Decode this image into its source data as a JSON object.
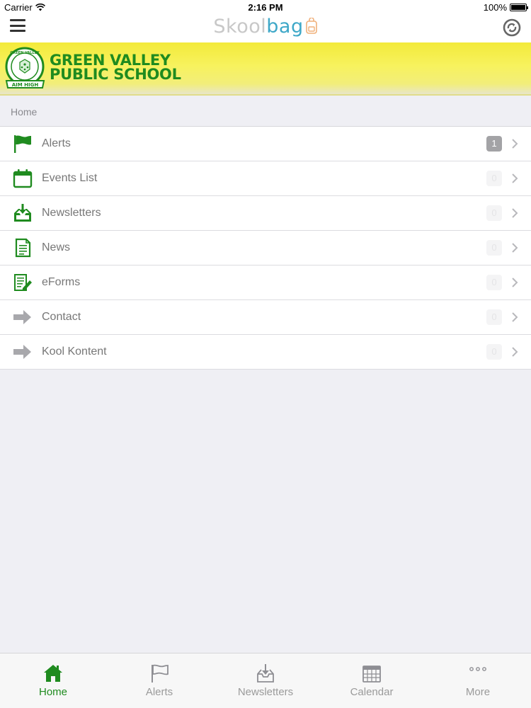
{
  "status_bar": {
    "carrier": "Carrier",
    "time": "2:16 PM",
    "battery": "100%"
  },
  "nav_bar": {
    "logo_part1": "Skool",
    "logo_part2": "bag"
  },
  "banner": {
    "school_line1": "GREEN VALLEY",
    "school_line2": "PUBLIC SCHOOL",
    "crest_motto": "AIM HIGH",
    "crest_top": "GREEN VALLEY"
  },
  "breadcrumb": "Home",
  "menu": [
    {
      "label": "Alerts",
      "badge": "1",
      "icon": "flag-icon"
    },
    {
      "label": "Events List",
      "badge": "0",
      "icon": "calendar-icon"
    },
    {
      "label": "Newsletters",
      "badge": "0",
      "icon": "inbox-download-icon"
    },
    {
      "label": "News",
      "badge": "0",
      "icon": "document-icon"
    },
    {
      "label": "eForms",
      "badge": "0",
      "icon": "form-edit-icon"
    },
    {
      "label": "Contact",
      "badge": "0",
      "icon": "arrow-right-icon"
    },
    {
      "label": "Kool Kontent",
      "badge": "0",
      "icon": "arrow-right-icon"
    }
  ],
  "tabs": [
    {
      "label": "Home",
      "icon": "home-icon",
      "active": true
    },
    {
      "label": "Alerts",
      "icon": "flag-icon"
    },
    {
      "label": "Newsletters",
      "icon": "inbox-download-icon"
    },
    {
      "label": "Calendar",
      "icon": "calendar-grid-icon"
    },
    {
      "label": "More",
      "icon": "more-dots-icon"
    }
  ],
  "colors": {
    "brand_green": "#1f8b1f",
    "banner_yellow": "#f3ea3a",
    "logo_blue": "#3ea8c8"
  }
}
